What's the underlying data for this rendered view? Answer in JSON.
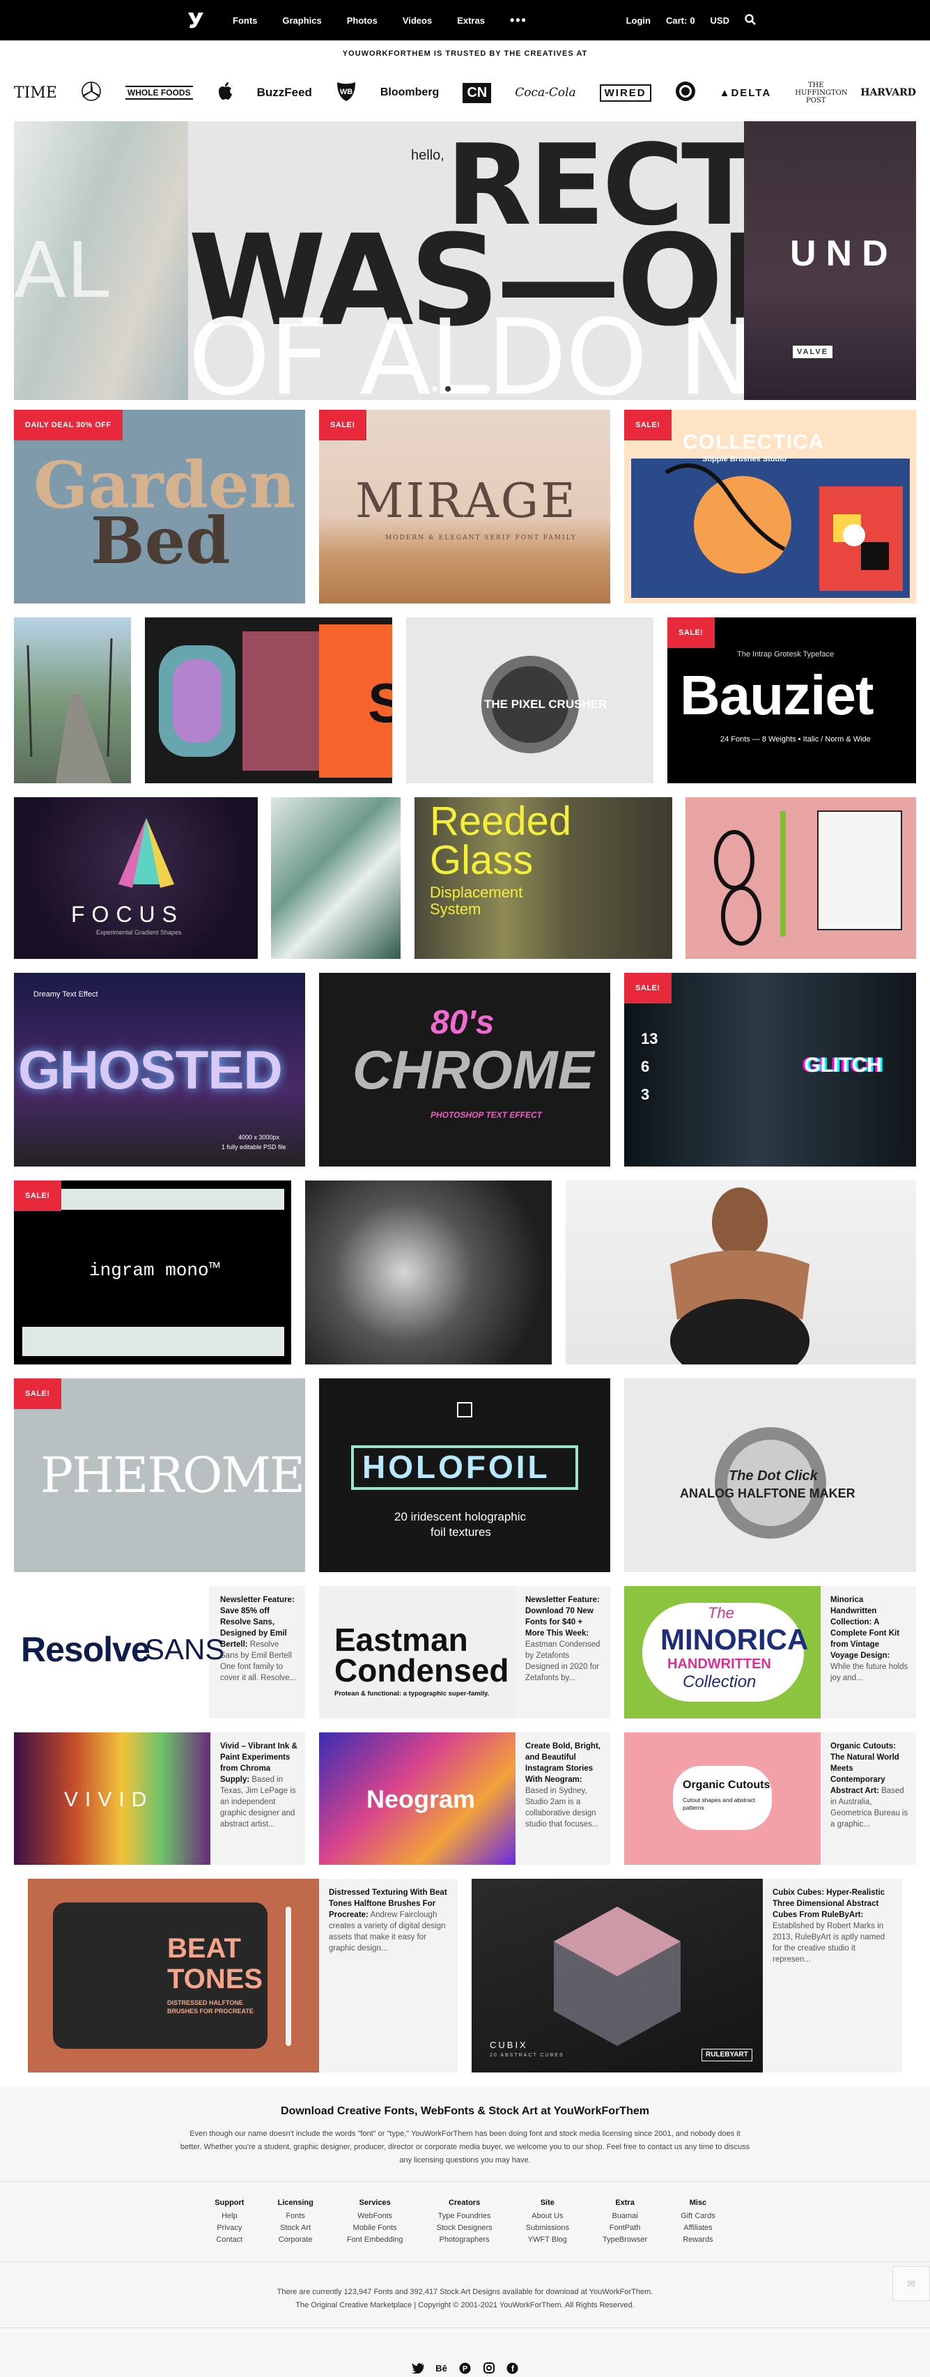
{
  "nav": {
    "links": [
      "Fonts",
      "Graphics",
      "Photos",
      "Videos",
      "Extras"
    ],
    "more": "•••",
    "login": "Login",
    "cart_label": "Cart:",
    "cart_count": "0",
    "currency": "USD"
  },
  "trust": {
    "heading": "YOUWORKFORTHEM IS TRUSTED BY THE CREATIVES AT",
    "brands": [
      "TIME",
      "Mercedes-Benz",
      "WHOLE FOODS",
      "Apple",
      "BuzzFeed",
      "Warner Bros",
      "Bloomberg",
      "CN",
      "Coca-Cola",
      "WIRED",
      "Starbucks",
      "DELTA",
      "THE HUFFINGTON POST",
      "HARVARD"
    ]
  },
  "hero": {
    "left_text": "AL",
    "hello": "hello,",
    "line1": "RECTA",
    "line2": "WAS—ONE",
    "line3": "OF ALDO NOV",
    "right_text": "UND",
    "valve": "VALVE"
  },
  "badges": {
    "daily": "DAILY DEAL 30% OFF",
    "sale": "SALE!"
  },
  "tiles": {
    "garden": [
      "Garden",
      "Bed"
    ],
    "mirage": {
      "title": "MIRAGE",
      "sub": "MODERN & ELEGANT SERIF FONT FAMILY"
    },
    "collectica": {
      "title": "COLLECTICA",
      "sub": "Stipple Brushes Studio"
    },
    "pixel": "THE PIXEL CRUSHER",
    "bauziet": {
      "title": "Bauziet",
      "top": "The Intrap Grotesk Typeface",
      "sub": "24 Fonts — 8 Weights • Italic / Norm & Wide"
    },
    "focus": {
      "title": "FOCUS",
      "sub": "Experimental Gradient Shapes"
    },
    "reeded": [
      "Reeded",
      "Glass",
      "Displacement",
      "System"
    ],
    "ghosted": {
      "title": "GHOSTED",
      "tag": "Dreamy Text Effect",
      "meta1": "4000 x 3000px",
      "meta2": "1 fully editable PSD file"
    },
    "chrome": {
      "title": "CHROME",
      "top": "80's",
      "sub": "PHOTOSHOP TEXT EFFECT"
    },
    "glitch": {
      "title": "GLITCH",
      "nums": [
        "13",
        "6",
        "3"
      ]
    },
    "ingram": "ingram mono™",
    "pherome": "PHEROME",
    "holofoil": {
      "title": "HOLOFOIL",
      "sub1": "20 iridescent holographic",
      "sub2": "foil textures"
    },
    "halftone": {
      "title": "ANALOG HALFTONE MAKER",
      "top": "The Dot Click"
    }
  },
  "news": [
    {
      "img_text": [
        "Resolve",
        "SANS"
      ],
      "title": "Newsletter Feature: Save 85% off Resolve Sans, Designed by Emil Bertell:",
      "body": "Resolve Sans by Emil Bertell One font family to cover it all. Resolve..."
    },
    {
      "img_text": [
        "Eastman",
        "Condensed"
      ],
      "img_sub": "Protean & functional: a typographic super-family.",
      "title": "Newsletter Feature: Download 70 New Fonts for $40 + More This Week:",
      "body": "Eastman Condensed by Zetafonts Designed in 2020 for Zetafonts by..."
    },
    {
      "img_text": [
        "The",
        "MINORICA",
        "HANDWRITTEN",
        "Collection"
      ],
      "title": "Minorica Handwritten Collection: A Complete Font Kit from Vintage Voyage Design:",
      "body": "While the future holds joy and..."
    },
    {
      "img_text": [
        "VIVID"
      ],
      "title": "Vivid – Vibrant Ink & Paint Experiments from Chroma Supply:",
      "body": "Based in Texas, Jim LePage is an independent graphic designer and abstract artist..."
    },
    {
      "img_text": [
        "Neogram"
      ],
      "title": "Create Bold, Bright, and Beautiful Instagram Stories With Neogram:",
      "body": "Based in Sydney, Studio 2am is a collaborative design studio that focuses..."
    },
    {
      "img_text": [
        "Organic Cutouts"
      ],
      "img_sub": "Cutout shapes and abstract patterns",
      "title": "Organic Cutouts: The Natural World Meets Contemporary Abstract Art:",
      "body": "Based in Australia, Geometrica Bureau is a graphic..."
    },
    {
      "img_text": [
        "BEAT",
        "TONES"
      ],
      "img_sub": "DISTRESSED HALFTONE BRUSHES FOR PROCREATE",
      "title": "Distressed Texturing With Beat Tones Halftone Brushes For Procreate:",
      "body": "Andrew Fairclough creates a variety of digital design assets that make it easy for graphic design..."
    },
    {
      "img_text": [
        "CUBIX"
      ],
      "img_sub": "20 ABSTRACT CUBES",
      "img_brand": "RULEBYART",
      "title": "Cubix Cubes: Hyper-Realistic Three Dimensional Abstract Cubes From RuleByArt:",
      "body": "Established by Robert Marks in 2013, RuleByArt is aptly named for the creative studio it represen..."
    }
  ],
  "footer": {
    "heading": "Download Creative Fonts, WebFonts & Stock Art at YouWorkForThem",
    "paragraph": "Even though our name doesn't include the words \"font\" or \"type,\" YouWorkForThem has been doing font and stock media licensing since 2001, and nobody does it better. Whether you're a student, graphic designer, producer, director or corporate media buyer, we welcome you to our shop. Feel free to contact us any time to discuss any licensing questions you may have.",
    "columns": [
      {
        "title": "Support",
        "items": [
          "Help",
          "Privacy",
          "Contact"
        ]
      },
      {
        "title": "Licensing",
        "items": [
          "Fonts",
          "Stock Art",
          "Corporate"
        ]
      },
      {
        "title": "Services",
        "items": [
          "WebFonts",
          "Mobile Fonts",
          "Font Embedding"
        ]
      },
      {
        "title": "Creators",
        "items": [
          "Type Foundries",
          "Stock Designers",
          "Photographers"
        ]
      },
      {
        "title": "Site",
        "items": [
          "About Us",
          "Submissions",
          "YWFT Blog"
        ]
      },
      {
        "title": "Extra",
        "items": [
          "Buamai",
          "FontPath",
          "TypeBrowser"
        ]
      },
      {
        "title": "Misc",
        "items": [
          "Gift Cards",
          "Affiliates",
          "Rewards"
        ]
      }
    ],
    "stats": "There are currently 123,947 Fonts and 392,417 Stock Art Designs available for download at YouWorkForThem.",
    "copyright": "The Original Creative Marketplace | Copyright © 2001-2021 YouWorkForThem. All Rights Reserved."
  },
  "colors": {
    "sale_red": "#e8283b",
    "nav_bg": "#000000",
    "footer_bg": "#f6f6f6"
  }
}
